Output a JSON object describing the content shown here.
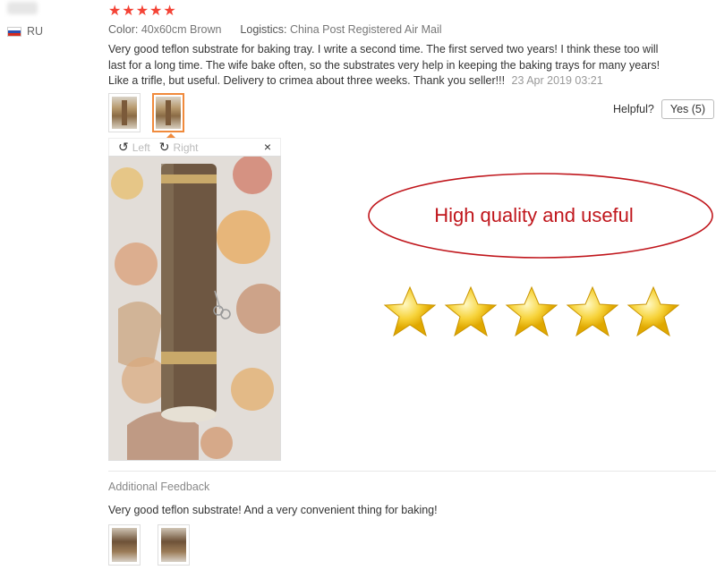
{
  "buyer": {
    "country": "RU"
  },
  "review": {
    "rating": "★★★★★",
    "color_label": "Color:",
    "color_value": "40x60cm Brown",
    "logistics_label": "Logistics:",
    "logistics_value": "China Post Registered Air Mail",
    "text": "Very good teflon substrate for baking tray. I write a second time. The first served two years! I think these too will last for a long time. The wife bake often, so the substrates very help in keeping the baking trays for many years! Like a trifle, but useful. Delivery to crimea about three weeks. Thank you seller!!!",
    "date": "23 Apr 2019 03:21"
  },
  "helpful": {
    "label": "Helpful?",
    "yes_button": "Yes (5)"
  },
  "viewer": {
    "left_label": "Left",
    "right_label": "Right",
    "close": "×"
  },
  "overlay": {
    "caption": "High quality and useful",
    "stars_count": 5,
    "star_color": "#f7d33a",
    "oval_color": "#c0161c"
  },
  "additional": {
    "title": "Additional Feedback",
    "text": "Very good teflon substrate! And a very convenient thing for baking!"
  },
  "colors": {
    "accent": "#f44336",
    "thumb_active": "#f08a3c"
  }
}
